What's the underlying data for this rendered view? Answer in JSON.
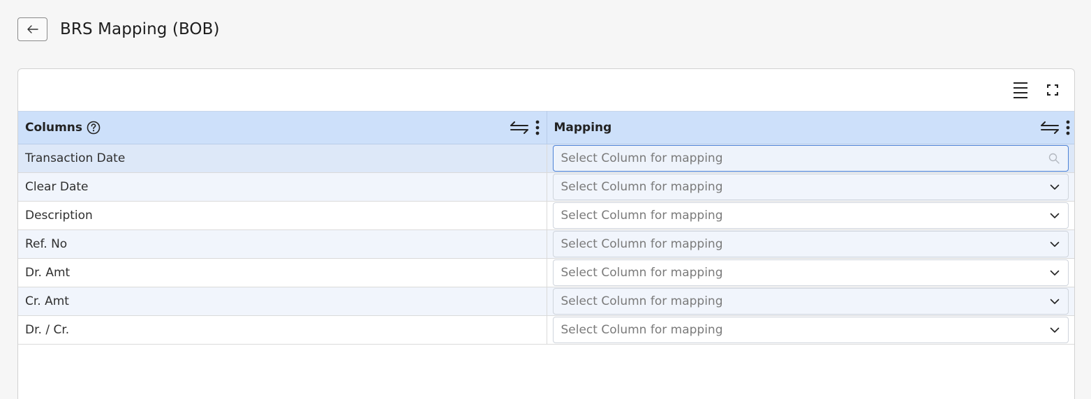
{
  "page": {
    "title": "BRS Mapping (BOB)"
  },
  "table": {
    "columns": [
      {
        "label": "Columns"
      },
      {
        "label": "Mapping"
      }
    ],
    "rows": [
      {
        "column": "Transaction Date",
        "mapping_placeholder": "Select Column for mapping"
      },
      {
        "column": "Clear Date",
        "mapping_placeholder": "Select Column for mapping"
      },
      {
        "column": "Description",
        "mapping_placeholder": "Select Column for mapping"
      },
      {
        "column": "Ref. No",
        "mapping_placeholder": "Select Column for mapping"
      },
      {
        "column": "Dr. Amt",
        "mapping_placeholder": "Select Column for mapping"
      },
      {
        "column": "Cr. Amt",
        "mapping_placeholder": "Select Column for mapping"
      },
      {
        "column": "Dr. / Cr.",
        "mapping_placeholder": "Select Column for mapping"
      }
    ]
  },
  "icons": {
    "back": "arrow-left-icon",
    "density": "density-lines-icon",
    "fullscreen": "fullscreen-icon",
    "help": "question-circle-icon",
    "sort": "swap-arrows-icon",
    "menu": "vertical-dots-icon",
    "dropdown": "chevron-down-icon",
    "search": "search-icon"
  },
  "colors": {
    "header_bg": "#cde0fa",
    "row_alt_bg": "#f1f5fc",
    "selected_row_bg": "#dde8f8",
    "focus_border": "#4d82d6"
  }
}
